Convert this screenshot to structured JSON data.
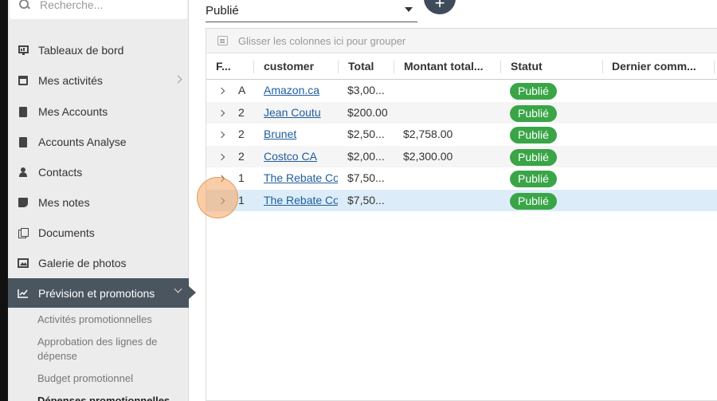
{
  "sidebar": {
    "search_placeholder": "Recherche...",
    "items": [
      {
        "label": "Tableaux de bord"
      },
      {
        "label": "Mes activités"
      },
      {
        "label": "Mes Accounts"
      },
      {
        "label": "Accounts Analyse"
      },
      {
        "label": "Contacts"
      },
      {
        "label": "Mes notes"
      },
      {
        "label": "Documents"
      },
      {
        "label": "Galerie de photos"
      },
      {
        "label": "Prévision et promotions"
      }
    ],
    "subitems": [
      {
        "label": "Activités promotionnelles"
      },
      {
        "label": "Approbation des lignes de dépense"
      },
      {
        "label": "Budget promotionnel"
      },
      {
        "label": "Dépenses promotionnelles"
      }
    ]
  },
  "main": {
    "status_filter": "Publié",
    "fab_label": "+",
    "group_bar_text": "Glisser les colonnes ici pour grouper",
    "columns": [
      "F...",
      "customer",
      "Total",
      "Montant total...",
      "Statut",
      "Dernier comm..."
    ],
    "rows": [
      {
        "f": "A",
        "customer": "Amazon.ca",
        "total": "$3,00...",
        "montant": "",
        "statut": "Publié",
        "dernier": ""
      },
      {
        "f": "2",
        "customer": "Jean Coutu",
        "total": "$200.00",
        "montant": "",
        "statut": "Publié",
        "dernier": ""
      },
      {
        "f": "2",
        "customer": "Brunet",
        "total": "$2,50...",
        "montant": "$2,758.00",
        "statut": "Publié",
        "dernier": ""
      },
      {
        "f": "2",
        "customer": "Costco CA",
        "total": "$2,00...",
        "montant": "$2,300.00",
        "statut": "Publié",
        "dernier": ""
      },
      {
        "f": "1",
        "customer": "The Rebate Com",
        "total": "$7,50...",
        "montant": "",
        "statut": "Publié",
        "dernier": ""
      },
      {
        "f": "1",
        "customer": "The Rebate Com",
        "total": "$7,50...",
        "montant": "",
        "statut": "Publié",
        "dernier": ""
      }
    ]
  },
  "colors": {
    "sidebar_bg": "#ececec",
    "active_nav": "#4a5560",
    "badge_green": "#3aa547",
    "link_blue": "#1f5d9e",
    "selected_row": "#dcedf9"
  }
}
